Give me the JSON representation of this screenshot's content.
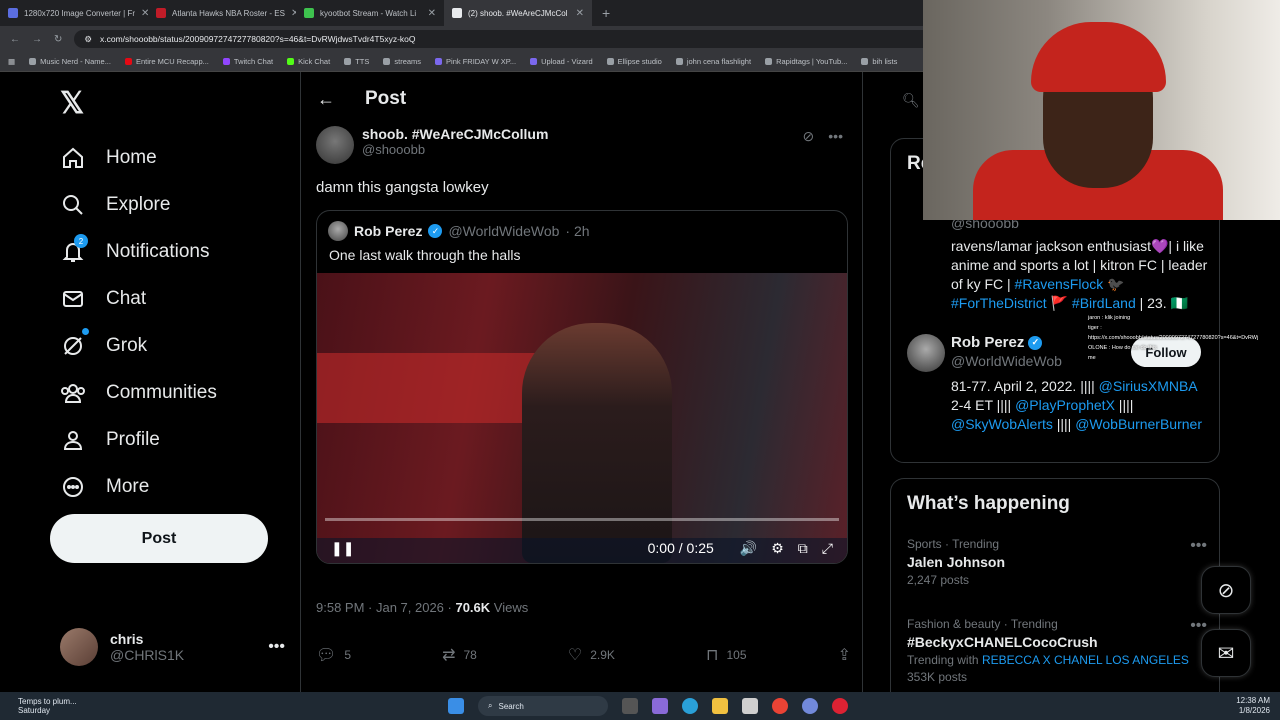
{
  "browser": {
    "tabs": [
      {
        "title": "1280x720 Image Converter | Fr",
        "color": "#5b6ee1"
      },
      {
        "title": "Atlanta Hawks NBA Roster - ES",
        "color": "#c01c28"
      },
      {
        "title": "kyootbot Stream - Watch Li",
        "color": "#3ec24e"
      },
      {
        "title": "(2) shoob. #WeAreCJMcCol",
        "color": "#e8eaed"
      }
    ],
    "address": "x.com/shooobb/status/2009097274727780820?s=46&t=DvRWjdwsTvdr4T5xyz-koQ",
    "bookmarks": [
      "Music Nerd - Name...",
      "Entire MCU Recapp...",
      "Twitch Chat",
      "Kick Chat",
      "TTS",
      "streams",
      "Pink FRIDAY W XP...",
      "Upload - Vizard",
      "Ellipse studio",
      "john cena flashlight",
      "Rapidtags | YouTub...",
      "bih lists"
    ]
  },
  "sidebar": {
    "nav": [
      {
        "label": "Home",
        "icon": "home-icon"
      },
      {
        "label": "Explore",
        "icon": "search-icon"
      },
      {
        "label": "Notifications",
        "icon": "bell-icon",
        "badge": "2"
      },
      {
        "label": "Chat",
        "icon": "mail-icon"
      },
      {
        "label": "Grok",
        "icon": "grok-icon"
      },
      {
        "label": "Communities",
        "icon": "communities-icon"
      },
      {
        "label": "Profile",
        "icon": "profile-icon"
      },
      {
        "label": "More",
        "icon": "more-circle-icon"
      }
    ],
    "post_button": "Post",
    "account": {
      "name": "chris",
      "handle": "@CHRlS1K"
    }
  },
  "main": {
    "title": "Post",
    "tweet": {
      "author_name": "shoob. #WeAreCJMcCollum",
      "author_handle": "@shooobb",
      "text": "damn this gangsta lowkey",
      "quote": {
        "author_name": "Rob Perez",
        "author_handle": "@WorldWideWob",
        "age": "· 2h",
        "text": "One last walk through the halls",
        "video": {
          "time": "0:00 / 0:25",
          "progress": 0.0
        }
      },
      "timestamp": "9:58 PM · Jan 7, 2026 · ",
      "views_count": "70.6K",
      "views_label": " Views",
      "replies": "5",
      "retweets": "78",
      "likes": "2.9K",
      "bookmarks": "105"
    }
  },
  "right": {
    "card_title_cut": "Re",
    "bio_handle": "@shooobb",
    "bio_text_1": "ravens/lamar jackson enthusiast💜| i like anime and sports a lot | kitron FC | leader of ky FC | ",
    "bio_link_1": "#RavensFlock",
    "bio_text_2": " 🐦‍⬛ ",
    "bio_link_2": "#ForTheDistrict",
    "bio_text_3": " 🚩 ",
    "bio_link_3": "#BirdLand",
    "bio_text_4": " | 23. 🇳🇬",
    "rob": {
      "name": "Rob Perez",
      "handle": "@WorldWideWob",
      "follow": "Follow",
      "bio_1": "81-77. April 2, 2022. |||| ",
      "link_1": "@SiriusXMNBA",
      "bio_2": " 2-4 ET |||| ",
      "link_2": "@PlayProphetX",
      "bio_3": " |||| ",
      "link_3": "@SkyWobAlerts",
      "bio_4": " |||| ",
      "link_4": "@WobBurnerBurner"
    },
    "whats_happening": "What’s happening",
    "trends": [
      {
        "context": "Sports · Trending",
        "name": "Jalen Johnson",
        "posts": "2,247 posts"
      },
      {
        "context": "Fashion & beauty · Trending",
        "name": "#BeckyxCHANELCocoCrush",
        "posts_prefix": "Trending with ",
        "posts_link": "REBECCA X CHANEL LOS ANGELES",
        "posts": "353K posts"
      }
    ]
  },
  "overlay_chat": {
    "line1": "jaron : klik joining",
    "line2": "tiger :",
    "line3": "https://x.com/shooobb/status/2009097274727780820?s=46&t=DvRWj",
    "line4": "OLONE : How do we do this",
    "line5": "me"
  },
  "taskbar": {
    "weather_1": "Temps to plum...",
    "weather_2": "Saturday",
    "search": "Search",
    "time": "12:38 AM",
    "date": "1/8/2026"
  },
  "colors": {
    "accent": "#1d9bf0",
    "background": "#000000",
    "border": "#2f3336",
    "muted": "#71767b"
  }
}
